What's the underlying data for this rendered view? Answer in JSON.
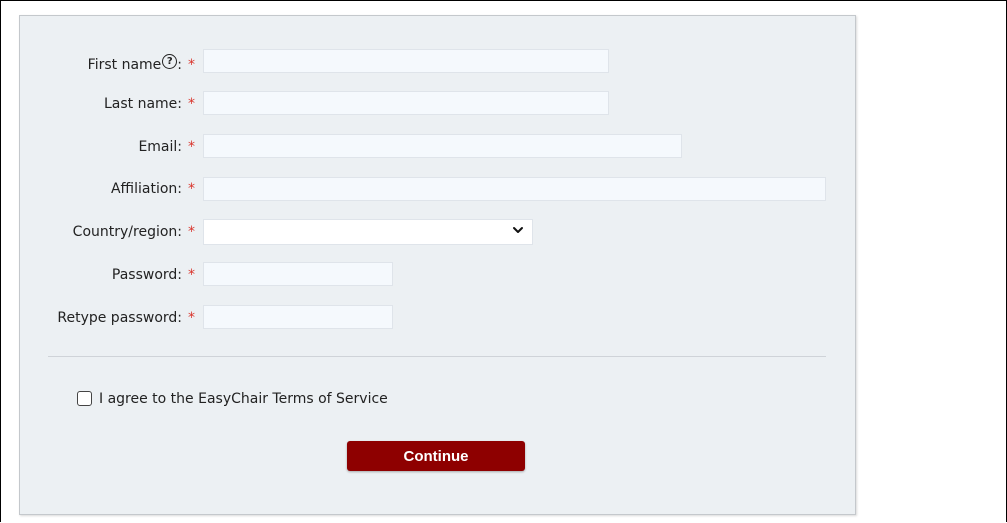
{
  "form": {
    "fields": [
      {
        "label": "First name",
        "suffix": ":",
        "required_mark": "*",
        "value": "",
        "help_icon": "question-circle-icon"
      },
      {
        "label": "Last name:",
        "required_mark": "*",
        "value": ""
      },
      {
        "label": "Email:",
        "required_mark": "*",
        "value": ""
      },
      {
        "label": "Affiliation:",
        "required_mark": "*",
        "value": ""
      },
      {
        "label": "Country/region:",
        "required_mark": "*",
        "selected": ""
      },
      {
        "label": "Password:",
        "required_mark": "*",
        "value": ""
      },
      {
        "label": "Retype password:",
        "required_mark": "*",
        "value": ""
      }
    ],
    "agree_label": "I agree to the EasyChair Terms of Service",
    "agree_checked": false,
    "continue_label": "Continue"
  },
  "colors": {
    "required": "#d9342b",
    "button": "#8e0000",
    "panel": "#ecf0f3"
  }
}
